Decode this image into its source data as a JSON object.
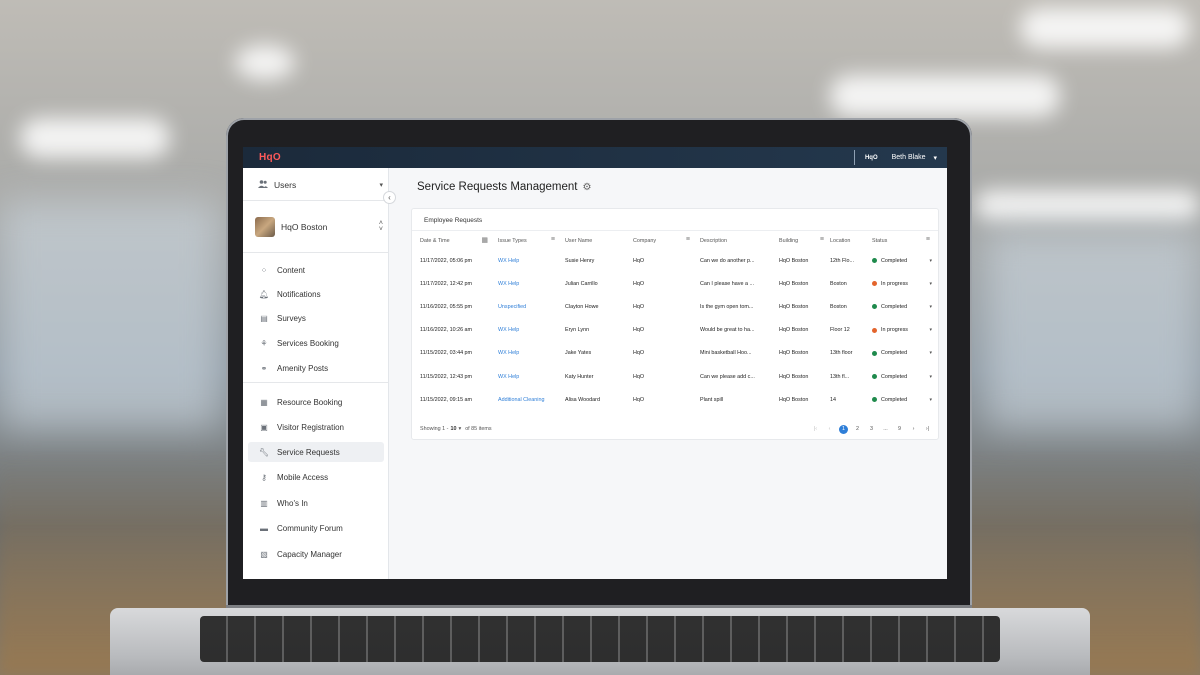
{
  "topbar": {
    "logo": "HqO",
    "right_logo": "HqO",
    "user": "Beth Blake"
  },
  "sidebar": {
    "users_label": "Users",
    "building": "HqO Boston",
    "items": [
      {
        "label": "Content",
        "icon": "grid-icon"
      },
      {
        "label": "Notifications",
        "icon": "bell-icon"
      },
      {
        "label": "Surveys",
        "icon": "survey-icon"
      },
      {
        "label": "Services Booking",
        "icon": "services-icon"
      },
      {
        "label": "Amenity Posts",
        "icon": "amenity-icon"
      },
      {
        "label": "Resource Booking",
        "icon": "calendar-icon"
      },
      {
        "label": "Visitor Registration",
        "icon": "visitor-icon"
      },
      {
        "label": "Service Requests",
        "icon": "wrench-icon",
        "active": true
      },
      {
        "label": "Mobile Access",
        "icon": "key-icon"
      },
      {
        "label": "Who's In",
        "icon": "badge-icon"
      },
      {
        "label": "Community Forum",
        "icon": "forum-icon"
      },
      {
        "label": "Capacity Manager",
        "icon": "capacity-icon"
      }
    ]
  },
  "main": {
    "title": "Service Requests Management",
    "card_title": "Employee Requests",
    "columns": [
      "Date & Time",
      "Issue Types",
      "User Name",
      "Company",
      "Description",
      "Building",
      "Location",
      "Status"
    ],
    "rows": [
      {
        "date": "11/17/2022, 05:06 pm",
        "issue": "WX Help",
        "user": "Susie Henry",
        "company": "HqO",
        "description": "Can we do another p...",
        "building": "HqO Boston",
        "location": "12th Flo...",
        "status": "Completed"
      },
      {
        "date": "11/17/2022, 12:42 pm",
        "issue": "WX Help",
        "user": "Julian Carrillo",
        "company": "HqO",
        "description": "Can I please have a ...",
        "building": "HqO Boston",
        "location": "Boston",
        "status": "In progress"
      },
      {
        "date": "11/16/2022, 05:55 pm",
        "issue": "Unspecified",
        "user": "Clayton Howe",
        "company": "HqO",
        "description": "Is the gym open tom...",
        "building": "HqO Boston",
        "location": "Boston",
        "status": "Completed"
      },
      {
        "date": "11/16/2022, 10:26 am",
        "issue": "WX Help",
        "user": "Eryn Lynn",
        "company": "HqO",
        "description": "Would be great to ha...",
        "building": "HqO Boston",
        "location": "Floor 12",
        "status": "In progress"
      },
      {
        "date": "11/15/2022, 03:44 pm",
        "issue": "WX Help",
        "user": "Jake Yates",
        "company": "HqO",
        "description": "Mini basketball Hoo...",
        "building": "HqO Boston",
        "location": "13th floor",
        "status": "Completed"
      },
      {
        "date": "11/15/2022, 12:43 pm",
        "issue": "WX Help",
        "user": "Katy Hunter",
        "company": "HqO",
        "description": "Can we please add c...",
        "building": "HqO Boston",
        "location": "13th fl...",
        "status": "Completed"
      },
      {
        "date": "11/15/2022, 09:15 am",
        "issue": "Additional Cleaning",
        "user": "Alisa Woodard",
        "company": "HqO",
        "description": "Plant spill",
        "building": "HqO Boston",
        "location": "14",
        "status": "Completed"
      }
    ],
    "pagination": {
      "showing_prefix": "Showing 1 -",
      "page_size": "10",
      "suffix": "of 85 items",
      "pages": [
        "1",
        "2",
        "3",
        "...",
        "9"
      ],
      "current": "1"
    }
  },
  "colors": {
    "completed": "#1f8a4c",
    "in_progress": "#e3642c",
    "link": "#2f7fd8",
    "topbar": "#1b2a3b"
  }
}
